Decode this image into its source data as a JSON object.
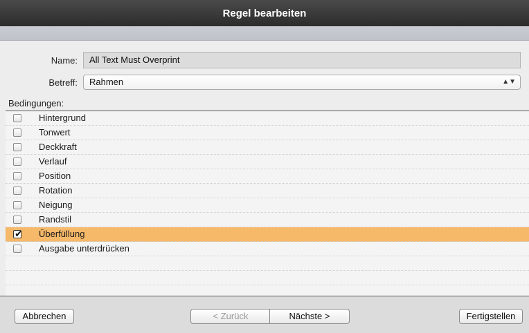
{
  "window": {
    "title": "Regel bearbeiten"
  },
  "form": {
    "name_label": "Name:",
    "name_value": "All Text Must Overprint",
    "subject_label": "Betreff:",
    "subject_value": "Rahmen",
    "conditions_label": "Bedingungen:"
  },
  "conditions": [
    {
      "label": "Hintergrund",
      "checked": false,
      "selected": false
    },
    {
      "label": "Tonwert",
      "checked": false,
      "selected": false
    },
    {
      "label": "Deckkraft",
      "checked": false,
      "selected": false
    },
    {
      "label": "Verlauf",
      "checked": false,
      "selected": false
    },
    {
      "label": "Position",
      "checked": false,
      "selected": false
    },
    {
      "label": "Rotation",
      "checked": false,
      "selected": false
    },
    {
      "label": "Neigung",
      "checked": false,
      "selected": false
    },
    {
      "label": "Randstil",
      "checked": false,
      "selected": false
    },
    {
      "label": "Überfüllung",
      "checked": true,
      "selected": true
    },
    {
      "label": "Ausgabe unterdrücken",
      "checked": false,
      "selected": false
    }
  ],
  "buttons": {
    "cancel": "Abbrechen",
    "back": "< Zurück",
    "next": "Nächste >",
    "finish": "Fertigstellen"
  },
  "colors": {
    "selection": "#f6b869",
    "titlebar": "#3a3a3a"
  }
}
